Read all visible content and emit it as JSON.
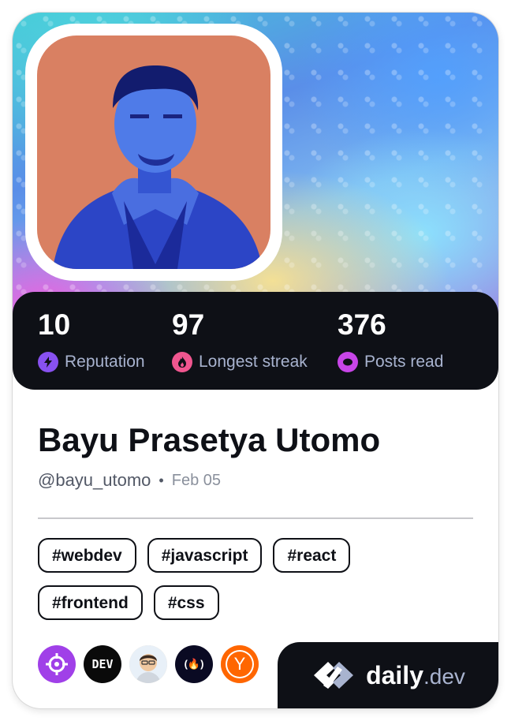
{
  "stats": [
    {
      "value": "10",
      "label": "Reputation",
      "icon": "bolt-icon",
      "color": "#8851f0"
    },
    {
      "value": "97",
      "label": "Longest streak",
      "icon": "flame-icon",
      "color": "#f0568f"
    },
    {
      "value": "376",
      "label": "Posts read",
      "icon": "ring-icon",
      "color": "#c845e8"
    }
  ],
  "profile": {
    "name": "Bayu Prasetya Utomo",
    "handle": "@bayu_utomo",
    "separator": "•",
    "date": "Feb 05"
  },
  "tags": [
    "#webdev",
    "#javascript",
    "#react",
    "#frontend",
    "#css"
  ],
  "sources": [
    {
      "icon": "crosshair-icon",
      "bg": "#a040e8"
    },
    {
      "icon": "dev-to-icon",
      "text": "DEV",
      "bg": "#0a0a0a"
    },
    {
      "icon": "memoji-avatar-icon",
      "bg": "#f2d8b6"
    },
    {
      "icon": "freecodecamp-icon",
      "text": "(🔥)",
      "bg": "#0a0a23"
    },
    {
      "icon": "hacker-news-icon",
      "text": "Y",
      "bg": "#ff6600"
    }
  ],
  "brand": {
    "name": "daily",
    "suffix": ".dev"
  }
}
